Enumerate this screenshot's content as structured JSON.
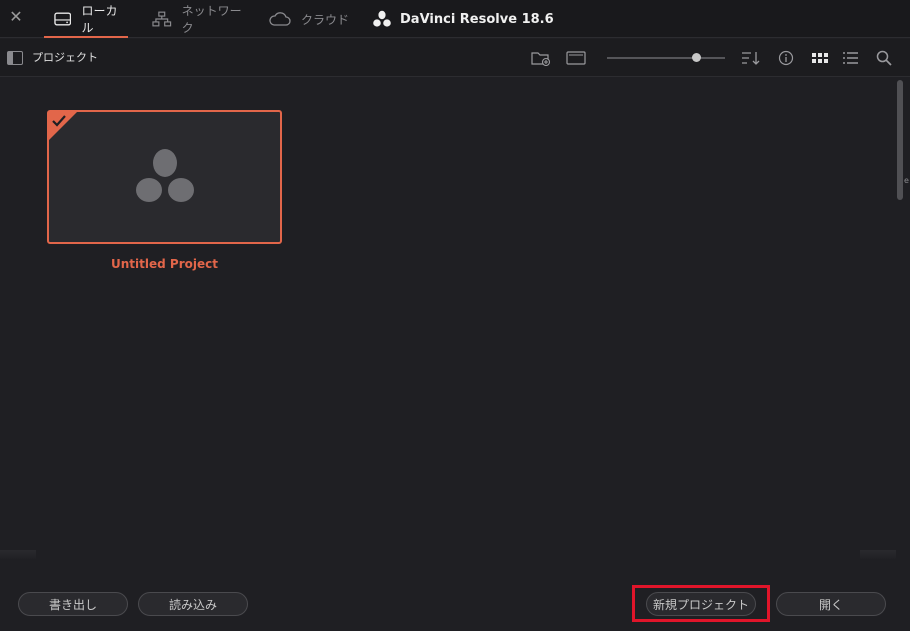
{
  "window": {
    "close_glyph": "✕",
    "tabs": [
      {
        "label": "ローカル",
        "icon": "drive-icon",
        "active": true
      },
      {
        "label": "ネットワーク",
        "icon": "network-icon",
        "active": false
      },
      {
        "label": "クラウド",
        "icon": "cloud-icon",
        "active": false
      }
    ],
    "app_title": "DaVinci Resolve 18.6",
    "app_icon": "davinci-logo-icon"
  },
  "toolbar": {
    "title": "プロジェクト",
    "icons": [
      "new-folder-icon",
      "folder-icon",
      "sort-icon",
      "info-icon",
      "grid-view-icon",
      "list-view-icon",
      "search-icon"
    ],
    "zoom_slider": {
      "value": 0.78
    }
  },
  "projects": [
    {
      "name": "Untitled Project",
      "selected": true
    }
  ],
  "bottom": {
    "export_label": "書き出し",
    "import_label": "読み込み",
    "new_project_label": "新規プロジェクト",
    "open_label": "開く"
  },
  "colors": {
    "accent": "#e2664a",
    "highlight": "#e0152a",
    "background": "#1f1f23"
  },
  "edge_mark": "e"
}
